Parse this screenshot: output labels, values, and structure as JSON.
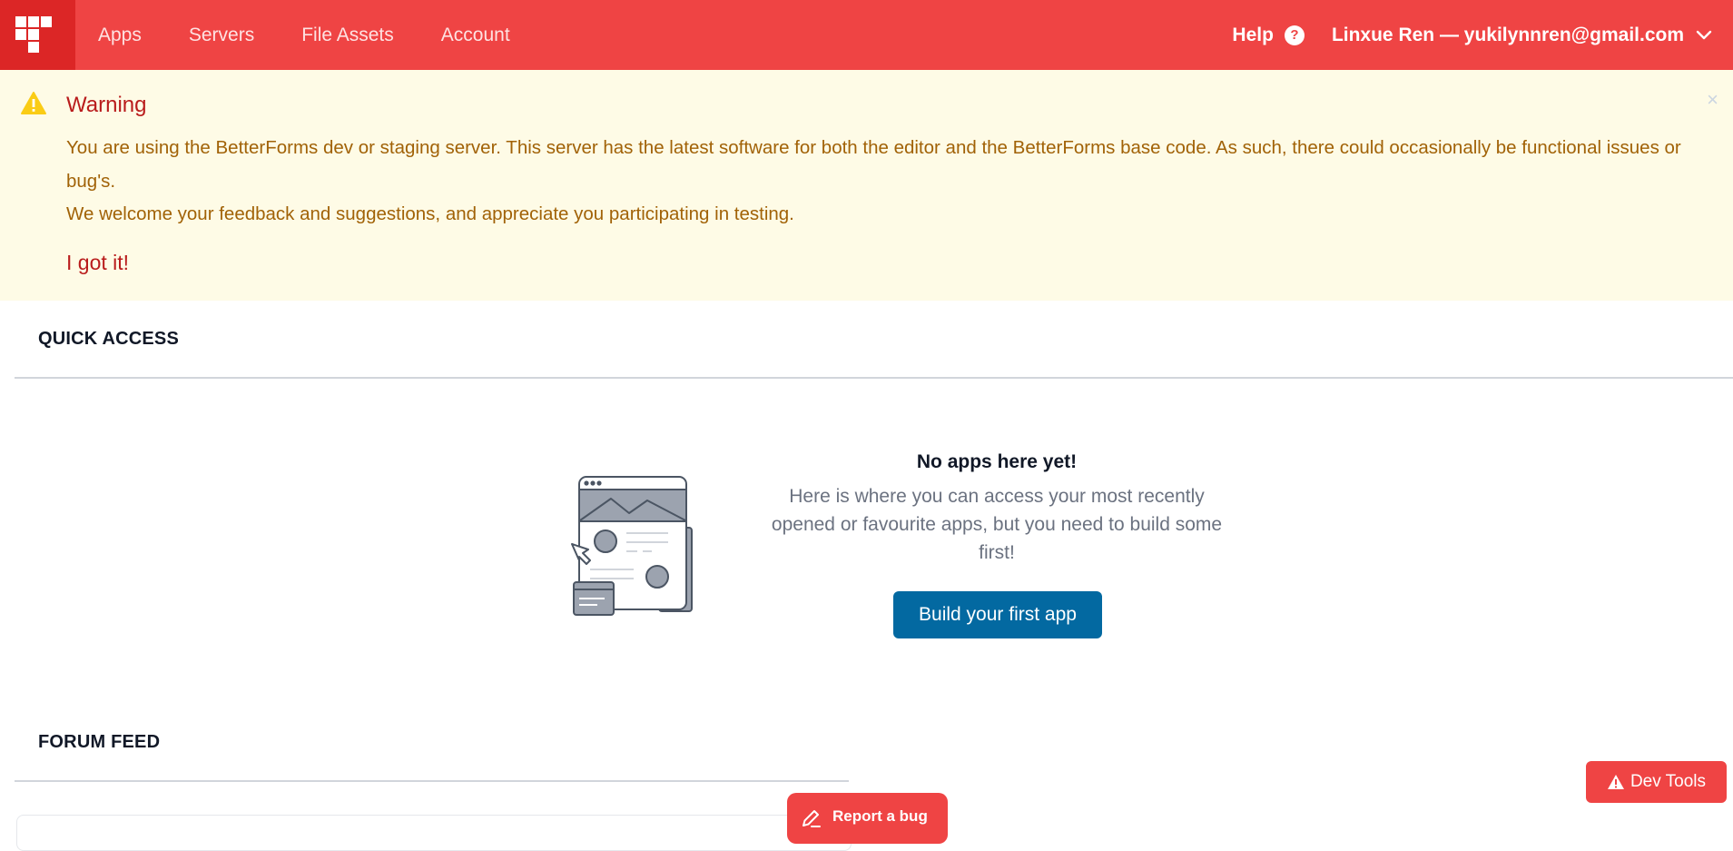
{
  "nav": {
    "links": [
      "Apps",
      "Servers",
      "File Assets",
      "Account"
    ],
    "help_label": "Help",
    "help_glyph": "?",
    "user_label": "Linxue Ren — yukilynnren@gmail.com",
    "colors": {
      "bar": "#ef4444",
      "logo_box": "#dc2626"
    }
  },
  "warning": {
    "title": "Warning",
    "close_glyph": "×",
    "line1": "You are using the BetterForms dev or staging server. This server has the latest software for both the editor and the BetterForms base code. As such, there could occasionally be functional issues or bug's.",
    "line2": "We welcome your feedback and suggestions, and appreciate you participating in testing.",
    "ack_label": "I got it!",
    "colors": {
      "background": "#fefbe6",
      "title": "#b91c1c",
      "text": "#a16207"
    }
  },
  "quick_access": {
    "title": "QUICK ACCESS",
    "empty_heading": "No apps here yet!",
    "empty_text": "Here is where you can access your most recently opened or favourite apps, but you need to build some first!",
    "build_button": "Build your first app",
    "colors": {
      "button": "#0369a1"
    }
  },
  "forum": {
    "title": "FORUM FEED"
  },
  "floating": {
    "report_bug": "Report a bug",
    "dev_tools": "Dev Tools"
  }
}
